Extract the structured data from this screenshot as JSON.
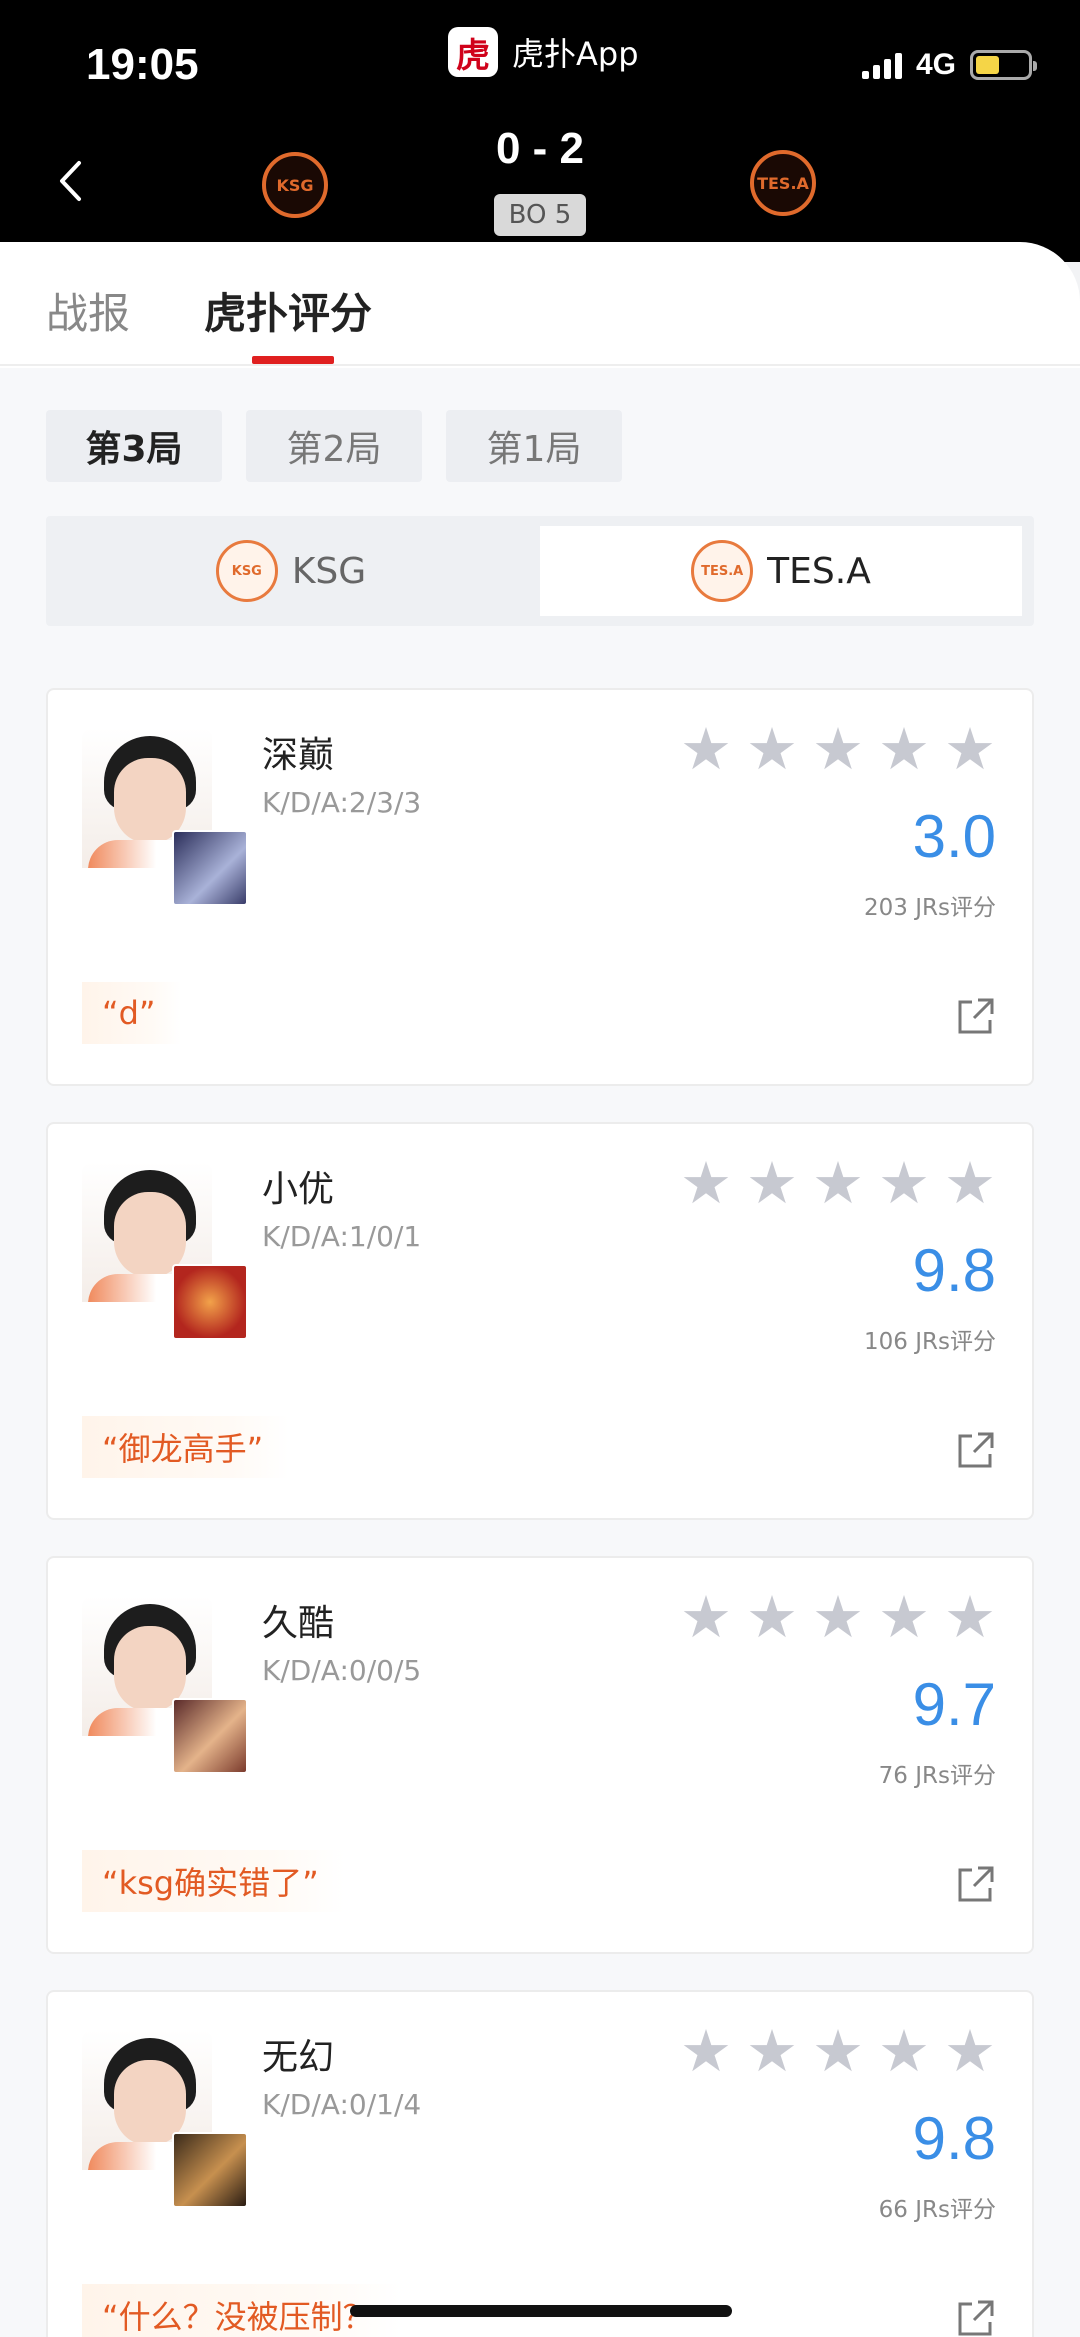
{
  "status_bar": {
    "time": "19:05",
    "network": "4G"
  },
  "app": {
    "logo_char": "虎",
    "name": "虎扑App"
  },
  "match": {
    "score": "0 - 2",
    "format": "BO 5",
    "home_team": "KSG",
    "away_team": "TES.A"
  },
  "tabs": [
    {
      "label": "战报"
    },
    {
      "label": "虎扑评分"
    }
  ],
  "game_tabs": [
    {
      "label": "第3局"
    },
    {
      "label": "第2局"
    },
    {
      "label": "第1局"
    }
  ],
  "team_switch": {
    "home": "KSG",
    "away": "TES.A",
    "selected": "TES.A"
  },
  "players": [
    {
      "name": "深巅",
      "kda": "K/D/A:2/3/3",
      "rating": "3.0",
      "count": "203 JRs评分",
      "quote": "“d”"
    },
    {
      "name": "小优",
      "kda": "K/D/A:1/0/1",
      "rating": "9.8",
      "count": "106 JRs评分",
      "quote": "“御龙高手”"
    },
    {
      "name": "久酷",
      "kda": "K/D/A:0/0/5",
      "rating": "9.7",
      "count": "76 JRs评分",
      "quote": "“ksg确实错了”"
    },
    {
      "name": "无幻",
      "kda": "K/D/A:0/1/4",
      "rating": "9.8",
      "count": "66 JRs评分",
      "quote": "“什么？没被压制？"
    }
  ],
  "colors": {
    "accent_red": "#e02020",
    "rating_blue": "#3a8ee6",
    "quote_orange": "#e25a23",
    "team_orange": "#e06a2c"
  }
}
